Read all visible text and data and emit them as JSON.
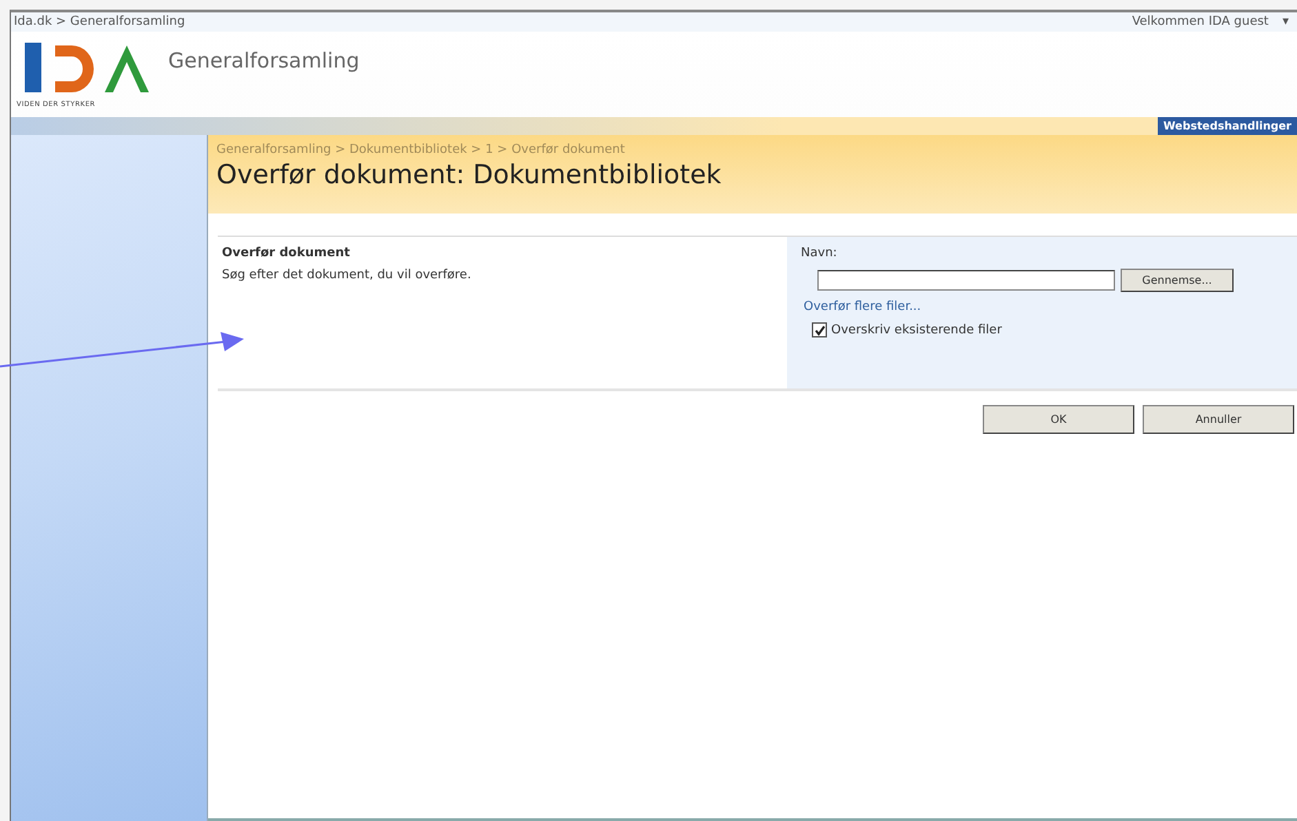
{
  "top_bar": {
    "breadcrumb": "Ida.dk > Generalforsamling",
    "welcome": "Velkommen IDA guest",
    "menu_caret": "▾"
  },
  "header": {
    "logo_tagline": "VIDEN DER STYRKER",
    "site_title": "Generalforsamling",
    "site_actions": "Webstedshandlinger"
  },
  "page": {
    "breadcrumb": "Generalforsamling > Dokumentbibliotek > 1 > Overfør dokument",
    "title": "Overfør dokument: Dokumentbibliotek"
  },
  "form": {
    "section_title": "Overfør dokument",
    "section_description": "Søg efter det dokument, du vil overføre.",
    "name_label": "Navn:",
    "browse_button": "Gennemse...",
    "multi_upload_link": "Overfør flere filer...",
    "overwrite": {
      "label": "Overskriv eksisterende filer",
      "checked": true
    }
  },
  "buttons": [
    "OK",
    "Annuller"
  ]
}
